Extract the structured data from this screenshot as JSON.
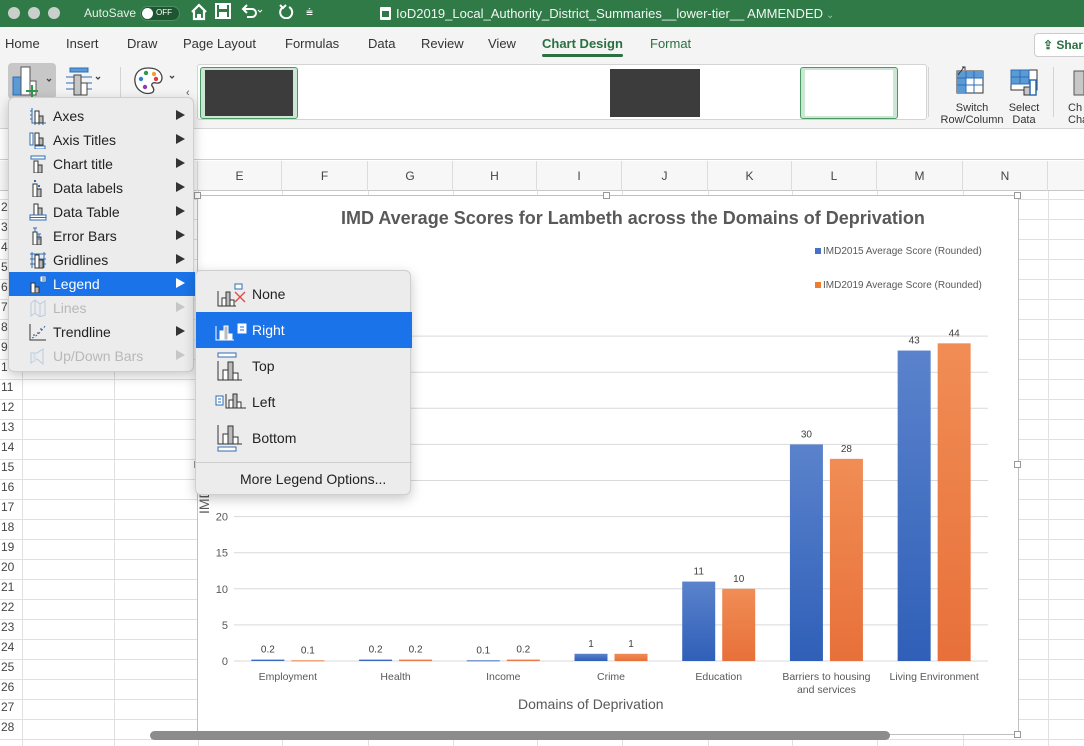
{
  "titlebar": {
    "autosave_label": "AutoSave",
    "autosave_state": "OFF",
    "doc_title": "IoD2019_Local_Authority_District_Summaries__lower-tier__ AMMENDED",
    "quick_access": [
      "home-icon",
      "save-icon",
      "undo-icon",
      "redo-icon",
      "customize-icon"
    ]
  },
  "tabs": [
    {
      "label": "Home"
    },
    {
      "label": "Insert"
    },
    {
      "label": "Draw"
    },
    {
      "label": "Page Layout"
    },
    {
      "label": "Formulas"
    },
    {
      "label": "Data"
    },
    {
      "label": "Review"
    },
    {
      "label": "View"
    },
    {
      "label": "Chart Design",
      "active": true
    },
    {
      "label": "Format"
    }
  ],
  "share_label": "Shar",
  "ribbon": {
    "switch_label_1": "Switch",
    "switch_label_2": "Row/Column",
    "select_label_1": "Select",
    "select_label_2": "Data",
    "change_label_1": "Ch",
    "change_label_2": "Cha"
  },
  "columns": [
    "E",
    "F",
    "G",
    "H",
    "I",
    "J",
    "K",
    "L",
    "M",
    "N"
  ],
  "rows": [
    "11",
    "12",
    "13",
    "14",
    "15",
    "16",
    "17",
    "18",
    "19",
    "20",
    "21",
    "22",
    "23",
    "24",
    "25",
    "26",
    "27",
    "28"
  ],
  "chart_element_menu": {
    "items": [
      {
        "label": "Axes",
        "icon": "axes-icon",
        "enabled": true
      },
      {
        "label": "Axis Titles",
        "icon": "axis-titles-icon",
        "enabled": true
      },
      {
        "label": "Chart title",
        "icon": "chart-title-icon",
        "enabled": true
      },
      {
        "label": "Data labels",
        "icon": "data-labels-icon",
        "enabled": true
      },
      {
        "label": "Data Table",
        "icon": "data-table-icon",
        "enabled": true
      },
      {
        "label": "Error Bars",
        "icon": "error-bars-icon",
        "enabled": true
      },
      {
        "label": "Gridlines",
        "icon": "gridlines-icon",
        "enabled": true
      },
      {
        "label": "Legend",
        "icon": "legend-icon",
        "enabled": true,
        "highlighted": true
      },
      {
        "label": "Lines",
        "icon": "lines-icon",
        "enabled": false
      },
      {
        "label": "Trendline",
        "icon": "trendline-icon",
        "enabled": true
      },
      {
        "label": "Up/Down Bars",
        "icon": "up-down-bars-icon",
        "enabled": false
      }
    ]
  },
  "legend_submenu": {
    "items": [
      {
        "label": "None",
        "icon": "legend-none-icon"
      },
      {
        "label": "Right",
        "icon": "legend-right-icon",
        "highlighted": true
      },
      {
        "label": "Top",
        "icon": "legend-top-icon"
      },
      {
        "label": "Left",
        "icon": "legend-left-icon"
      },
      {
        "label": "Bottom",
        "icon": "legend-bottom-icon"
      }
    ],
    "more_label": "More Legend Options..."
  },
  "colors": {
    "series_2015": "#4472c4",
    "series_2019": "#ed7d31",
    "accent_green": "#2a7041",
    "menu_highlight": "#1a73e8"
  },
  "chart_data": {
    "type": "bar",
    "title": "IMD Average Scores for Lambeth across the Domains of Deprivation",
    "xlabel": "Domains of Deprivation",
    "ylabel": "IMD Average Score",
    "ylabel_visible": "IMD Av",
    "categories": [
      "Employment",
      "Health",
      "Income",
      "Crime",
      "Education",
      "Barriers to housing and services",
      "Living Environment"
    ],
    "category_lines": [
      [
        "Employment"
      ],
      [
        "Health"
      ],
      [
        "Income"
      ],
      [
        "Crime"
      ],
      [
        "Education"
      ],
      [
        "Barriers to housing",
        "and services"
      ],
      [
        "Living Environment"
      ]
    ],
    "series": [
      {
        "name": "IMD2015 Average Score (Rounded)",
        "values": [
          0.2,
          0.2,
          0.1,
          1,
          11,
          30,
          43
        ]
      },
      {
        "name": "IMD2019 Average Score (Rounded)",
        "values": [
          0.1,
          0.2,
          0.2,
          1,
          10,
          28,
          44
        ]
      }
    ],
    "yticks_visible": [
      0,
      5,
      10,
      15,
      20
    ],
    "ylim": [
      0,
      45
    ],
    "grid": true,
    "legend_position": "top-right"
  }
}
